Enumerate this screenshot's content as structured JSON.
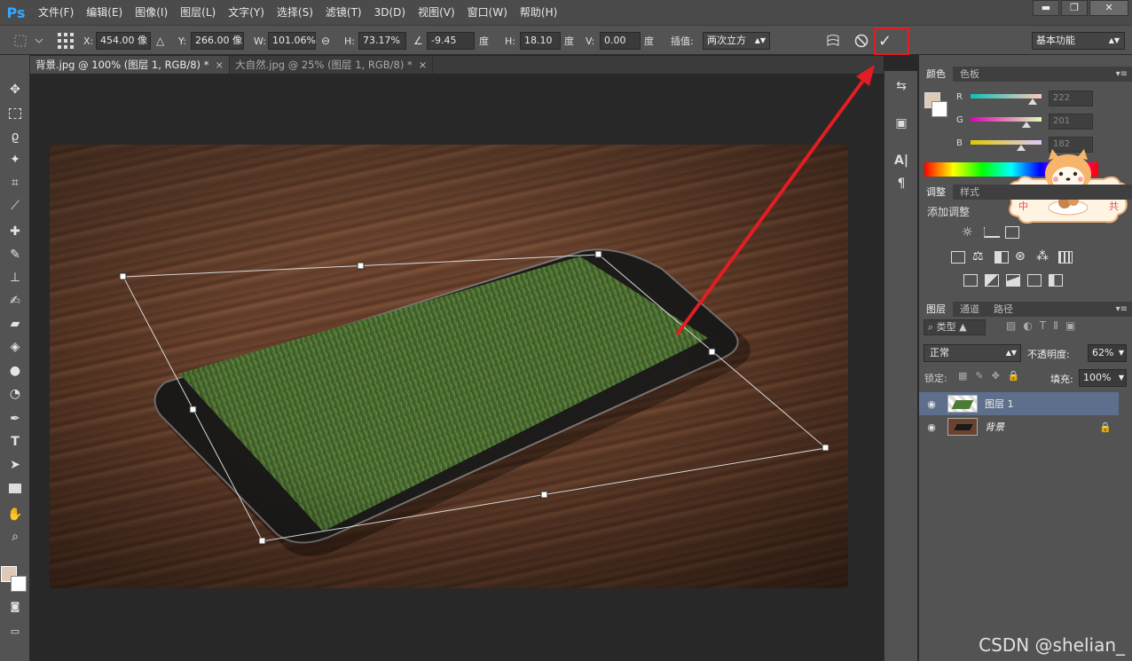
{
  "app": {
    "logo": "Ps",
    "menu": [
      "文件(F)",
      "编辑(E)",
      "图像(I)",
      "图层(L)",
      "文字(Y)",
      "选择(S)",
      "滤镜(T)",
      "3D(D)",
      "视图(V)",
      "窗口(W)",
      "帮助(H)"
    ],
    "window_controls": [
      "▬",
      "❐",
      "✕"
    ]
  },
  "options": {
    "x_label": "X:",
    "x_value": "454.00 像",
    "y_label": "Y:",
    "y_value": "266.00 像",
    "w_label": "W:",
    "w_value": "101.06%",
    "h_label": "H:",
    "h_value": "73.17%",
    "angle_value": "-9.45",
    "deg_label": "度",
    "hskew_label": "H:",
    "hskew_value": "18.10",
    "vskew_label": "V:",
    "vskew_value": "0.00",
    "interp_label": "插值:",
    "interp_value": "两次立方",
    "workspace": "基本功能",
    "cancel_icon": "cancel-transform-icon",
    "commit_icon": "commit-transform-icon",
    "commit_glyph": "✓",
    "highlight_color": "#e21d23"
  },
  "tabs": [
    {
      "label": "背景.jpg @ 100% (图层 1, RGB/8) *",
      "close": "×"
    },
    {
      "label": "大自然.jpg @ 25% (图层 1, RGB/8) *",
      "close": "×"
    }
  ],
  "color_panel": {
    "tabs": [
      "颜色",
      "色板"
    ],
    "r_label": "R",
    "r_value": "222",
    "g_label": "G",
    "g_value": "201",
    "b_label": "B",
    "b_value": "182",
    "r_level": 0.87,
    "g_level": 0.79,
    "b_level": 0.71,
    "foreground": "#decab6"
  },
  "adjust_panel": {
    "tabs": [
      "调整",
      "样式"
    ],
    "title": "添加调整"
  },
  "layers_panel": {
    "tabs": [
      "图层",
      "通道",
      "路径"
    ],
    "filter_label": "类型",
    "blend_mode": "正常",
    "opacity_label": "不透明度:",
    "opacity_value": "62%",
    "lock_label": "锁定:",
    "fill_label": "填充:",
    "fill_value": "100%",
    "layers": [
      {
        "name": "图层 1",
        "selected": true
      },
      {
        "name": "背景",
        "selected": false
      }
    ]
  },
  "watermark": "CSDN @shelian_",
  "sticker_labels": [
    "中",
    "共"
  ]
}
